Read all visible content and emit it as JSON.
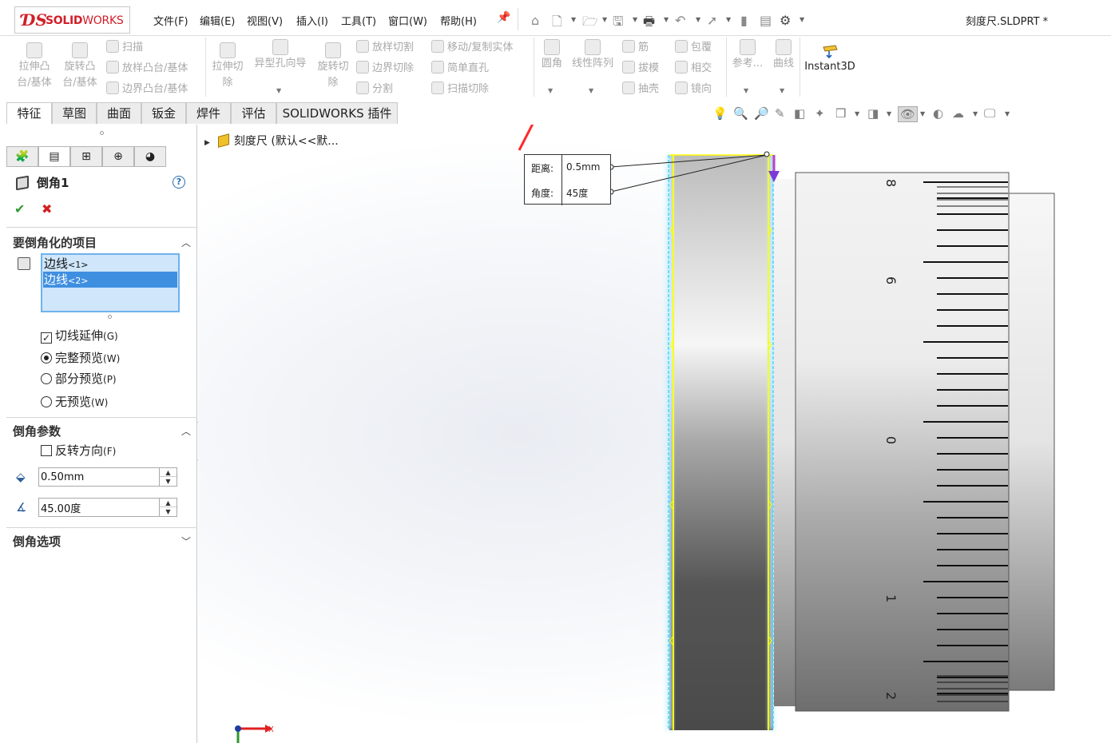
{
  "app": {
    "logo_ds": "ƊS",
    "logo_solid": "SOLID",
    "logo_works": "WORKS",
    "doc_title": "刻度尺.SLDPRT *"
  },
  "menu": [
    "文件(F)",
    "编辑(E)",
    "视图(V)",
    "插入(I)",
    "工具(T)",
    "窗口(W)",
    "帮助(H)"
  ],
  "commands": {
    "extrude_boss": "拉伸凸\n台/基体",
    "revolve_boss": "旋转凸\n台/基体",
    "sweep": "扫描",
    "loft_boss": "放样凸台/基体",
    "boundary_boss": "边界凸台/基体",
    "extrude_cut": "拉伸切\n除",
    "hole_wizard": "异型孔向导",
    "revolve_cut": "旋转切\n除",
    "loft_cut": "放样切割",
    "boundary_cut": "边界切除",
    "split": "分割",
    "move_copy_body": "移动/复制实体",
    "simple_hole": "简单直孔",
    "swept_cut": "扫描切除",
    "fillet": "圆角",
    "linear_pattern": "线性阵列",
    "rib": "筋",
    "draft": "拔模",
    "shell": "抽壳",
    "wrap": "包覆",
    "intersect": "相交",
    "mirror": "镜向",
    "reference": "参考...",
    "curves": "曲线",
    "instant3d": "Instant3D"
  },
  "tabs": [
    "特征",
    "草图",
    "曲面",
    "钣金",
    "焊件",
    "评估",
    "SOLIDWORKS 插件"
  ],
  "active_tab": "特征",
  "property_manager": {
    "title": "倒角1",
    "help": "?",
    "ok": "✔",
    "cancel": "✖",
    "items_section": "要倒角化的项目",
    "edges": [
      {
        "label": "边线",
        "sub": "<1>",
        "selected": false
      },
      {
        "label": "边线",
        "sub": "<2>",
        "selected": true
      }
    ],
    "tangent_propagation": {
      "label": "切线延伸",
      "key": "(G)",
      "checked": true
    },
    "preview_full": {
      "label": "完整预览",
      "key": "(W)",
      "selected": true
    },
    "preview_partial": {
      "label": "部分预览",
      "key": "(P)",
      "selected": false
    },
    "preview_none": {
      "label": "无预览",
      "key": "(W)",
      "selected": false
    },
    "params_section": "倒角参数",
    "flip_direction": {
      "label": "反转方向",
      "key": "(F)",
      "checked": false
    },
    "distance_value": "0.50mm",
    "angle_value": "45.00度",
    "options_section": "倒角选项"
  },
  "tree": {
    "root": "刻度尺  (默认<<默..."
  },
  "callout": {
    "distance_label": "距离:",
    "distance_value": "0.5mm",
    "angle_label": "角度:",
    "angle_value": "45度"
  },
  "triad": {
    "x_label": "X"
  },
  "colors": {
    "brand": "#d0202a",
    "selection_blue": "#3f8fe1",
    "list_bg": "#cfe6fb",
    "edge_highlight": "#ffff00",
    "edge_cyan": "#4fd2ff",
    "arrow_red": "#ff2a2a",
    "ok_green": "#2e9a32",
    "cancel_red": "#d42020"
  },
  "icons": {
    "pin": "pin-icon",
    "home": "home-icon",
    "new": "new-document-icon",
    "open": "open-folder-icon",
    "save": "save-icon",
    "print": "print-icon",
    "undo": "undo-icon",
    "select": "select-arrow-icon",
    "rebuild": "rebuild-icon",
    "options": "gear-icon"
  }
}
